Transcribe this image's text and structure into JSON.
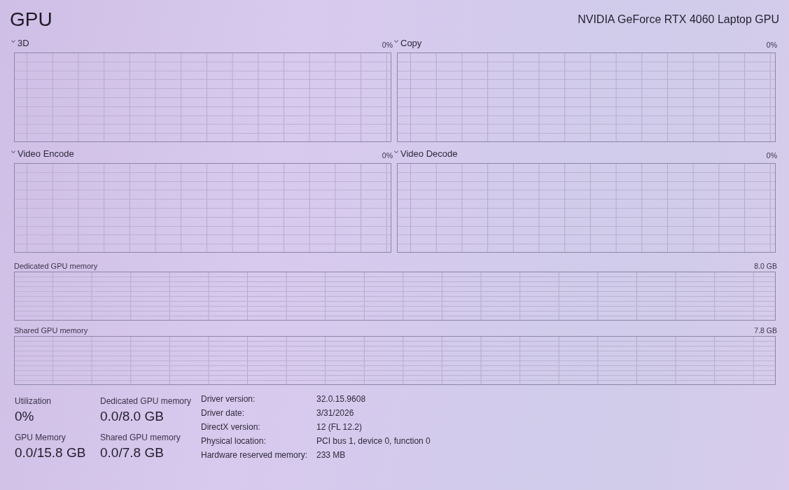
{
  "header": {
    "title": "GPU",
    "device_name": "NVIDIA GeForce RTX 4060 Laptop GPU"
  },
  "engine_graphs": [
    {
      "label": "3D",
      "value": "0%"
    },
    {
      "label": "Copy",
      "value": "0%"
    },
    {
      "label": "Video Encode",
      "value": "0%"
    },
    {
      "label": "Video Decode",
      "value": "0%"
    }
  ],
  "memory_graphs": [
    {
      "label": "Dedicated GPU memory",
      "max": "8.0 GB"
    },
    {
      "label": "Shared GPU memory",
      "max": "7.8 GB"
    }
  ],
  "stats": [
    {
      "label": "Utilization",
      "value": "0%"
    },
    {
      "label": "Dedicated GPU memory",
      "value": "0.0/8.0 GB"
    },
    {
      "label": "GPU Memory",
      "value": "0.0/15.8 GB"
    },
    {
      "label": "Shared GPU memory",
      "value": "0.0/7.8 GB"
    }
  ],
  "details": [
    {
      "label": "Driver version:",
      "value": "32.0.15.9608"
    },
    {
      "label": "Driver date:",
      "value": "3/31/2026"
    },
    {
      "label": "DirectX version:",
      "value": "12 (FL 12.2)"
    },
    {
      "label": "Physical location:",
      "value": "PCI bus 1, device 0, function 0"
    },
    {
      "label": "Hardware reserved memory:",
      "value": "233 MB"
    }
  ]
}
